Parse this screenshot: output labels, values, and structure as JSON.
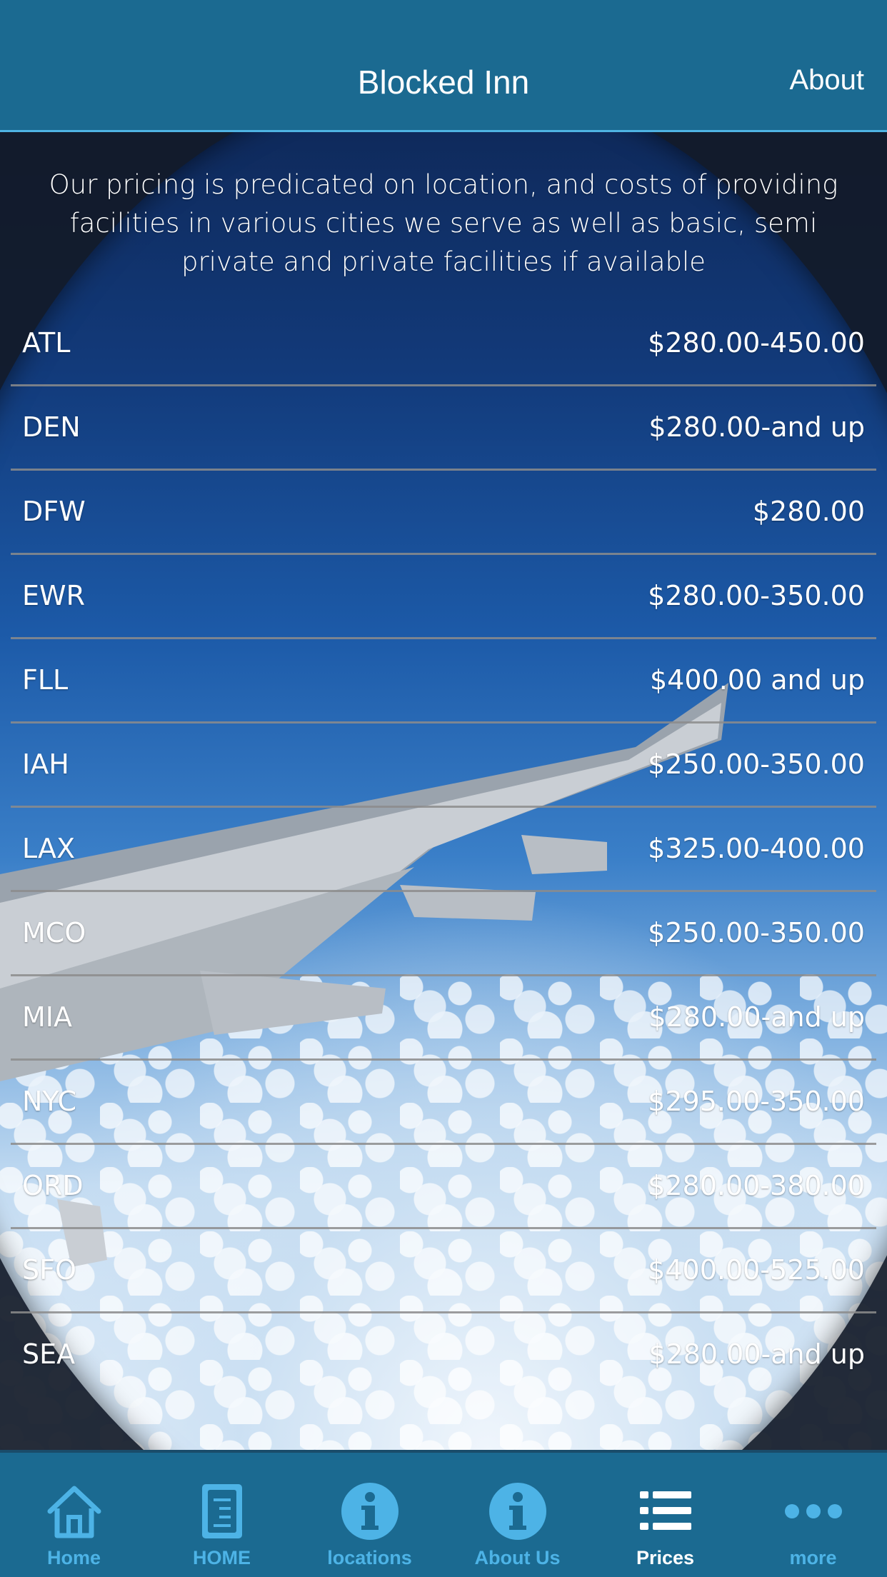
{
  "header": {
    "title": "Blocked Inn",
    "about_label": "About"
  },
  "intro": "Our pricing is predicated on location, and costs of providing facilities in various cities we serve as well as basic, semi private and private facilities if available",
  "prices": [
    {
      "code": "ATL",
      "price": "$280.00-450.00"
    },
    {
      "code": "DEN",
      "price": "$280.00-and up"
    },
    {
      "code": "DFW",
      "price": "$280.00"
    },
    {
      "code": "EWR",
      "price": "$280.00-350.00"
    },
    {
      "code": "FLL",
      "price": "$400.00 and up"
    },
    {
      "code": "IAH",
      "price": "$250.00-350.00"
    },
    {
      "code": "LAX",
      "price": "$325.00-400.00"
    },
    {
      "code": "MCO",
      "price": "$250.00-350.00"
    },
    {
      "code": "MIA",
      "price": "$280.00-and up"
    },
    {
      "code": "NYC",
      "price": "$295.00-350.00"
    },
    {
      "code": "ORD",
      "price": "$280.00-380.00"
    },
    {
      "code": "SFO",
      "price": "$400.00-525.00"
    },
    {
      "code": "SEA",
      "price": "$280.00-and up"
    }
  ],
  "tabs": [
    {
      "label": "Home",
      "icon": "house-icon"
    },
    {
      "label": "HOME",
      "icon": "document-icon"
    },
    {
      "label": "locations",
      "icon": "info-icon"
    },
    {
      "label": "About Us",
      "icon": "info-icon"
    },
    {
      "label": "Prices",
      "icon": "list-icon",
      "active": true
    },
    {
      "label": "more",
      "icon": "more-dots-icon"
    }
  ],
  "colors": {
    "header_bg": "#1b6a91",
    "accent": "#4db3e6",
    "active_tab": "#ffffff"
  }
}
